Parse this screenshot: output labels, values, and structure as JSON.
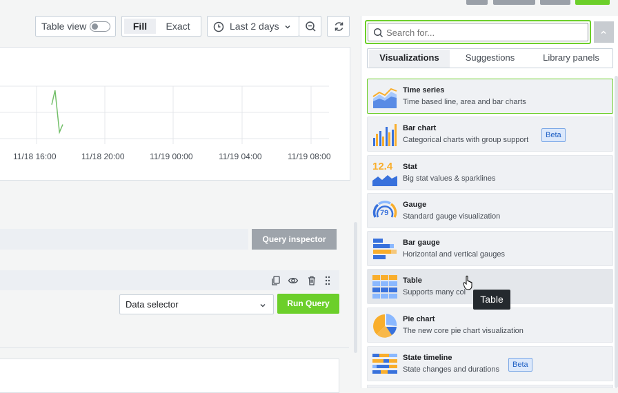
{
  "toolbar": {
    "table_view_label": "Table view",
    "fill_label": "Fill",
    "exact_label": "Exact",
    "time_range_label": "Last 2 days"
  },
  "chart_data": {
    "type": "line",
    "x_ticks": [
      "11/18 16:00",
      "11/18 20:00",
      "11/19 00:00",
      "11/19 04:00",
      "11/19 08:00"
    ],
    "series": [
      {
        "points": [
          [
            0.0,
            0.35
          ],
          [
            0.3,
            1.0
          ],
          [
            0.7,
            -0.9
          ],
          [
            1.0,
            -0.55
          ]
        ]
      }
    ],
    "color": "#73bf69"
  },
  "query": {
    "inspector_label": "Query inspector",
    "data_selector_label": "Data selector",
    "run_query_label": "Run Query"
  },
  "search": {
    "placeholder": "Search for..."
  },
  "tabs": {
    "visualizations": "Visualizations",
    "suggestions": "Suggestions",
    "library_panels": "Library panels"
  },
  "viz_list": [
    {
      "name": "Time series",
      "desc": "Time based line, area and bar charts"
    },
    {
      "name": "Bar chart",
      "desc": "Categorical charts with group support",
      "badge": "Beta"
    },
    {
      "name": "Stat",
      "desc": "Big stat values & sparklines",
      "icon_text": "12.4"
    },
    {
      "name": "Gauge",
      "desc": "Standard gauge visualization",
      "icon_text": "79"
    },
    {
      "name": "Bar gauge",
      "desc": "Horizontal and vertical gauges"
    },
    {
      "name": "Table",
      "desc": "Supports many col"
    },
    {
      "name": "Pie chart",
      "desc": "The new core pie chart visualization"
    },
    {
      "name": "State timeline",
      "desc": "State changes and durations",
      "badge": "Beta"
    }
  ],
  "tooltip": {
    "text": "Table"
  },
  "colors": {
    "accent_green": "#6ccf2a",
    "blue": "#3871dc",
    "yellow": "#f9ae2c"
  }
}
